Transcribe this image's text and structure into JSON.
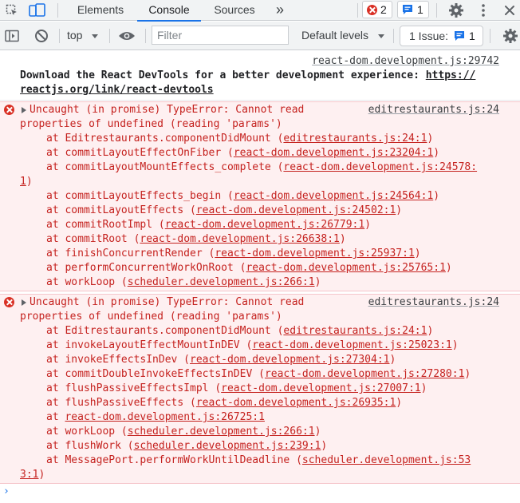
{
  "tabbar": {
    "tabs": [
      {
        "label": "Elements",
        "active": false
      },
      {
        "label": "Console",
        "active": true
      },
      {
        "label": "Sources",
        "active": false
      }
    ],
    "more_icon": "»",
    "error_count": "2",
    "message_count": "1"
  },
  "filterbar": {
    "context": "top",
    "filter_placeholder": "Filter",
    "levels": "Default levels",
    "issues_label": "1 Issue:",
    "issues_count": "1"
  },
  "console": {
    "info": {
      "source": "react-dom.development.js:29742",
      "text": "Download the React DevTools for a better development experience: ",
      "link_part1": "https://",
      "link_part2": "reactjs.org/link/react-devtools"
    },
    "errors": [
      {
        "head1": "Uncaught (in promise) TypeError: Cannot read",
        "head2": "properties of undefined (reading 'params')",
        "source": "editrestaurants.js:24",
        "stack": [
          {
            "prefix": "at Editrestaurants.componentDidMount (",
            "link": "editrestaurants.js:24:1",
            "suffix": ")"
          },
          {
            "prefix": "at commitLayoutEffectOnFiber (",
            "link": "react-dom.development.js:23204:1",
            "suffix": ")"
          },
          {
            "prefix": "at commitLayoutMountEffects_complete (",
            "link": "react-dom.development.js:24578:",
            "suffix": ""
          },
          {
            "prefix": "",
            "link": "1",
            "suffix": ")"
          },
          {
            "prefix": "at commitLayoutEffects_begin (",
            "link": "react-dom.development.js:24564:1",
            "suffix": ")"
          },
          {
            "prefix": "at commitLayoutEffects (",
            "link": "react-dom.development.js:24502:1",
            "suffix": ")"
          },
          {
            "prefix": "at commitRootImpl (",
            "link": "react-dom.development.js:26779:1",
            "suffix": ")"
          },
          {
            "prefix": "at commitRoot (",
            "link": "react-dom.development.js:26638:1",
            "suffix": ")"
          },
          {
            "prefix": "at finishConcurrentRender (",
            "link": "react-dom.development.js:25937:1",
            "suffix": ")"
          },
          {
            "prefix": "at performConcurrentWorkOnRoot (",
            "link": "react-dom.development.js:25765:1",
            "suffix": ")"
          },
          {
            "prefix": "at workLoop (",
            "link": "scheduler.development.js:266:1",
            "suffix": ")"
          }
        ]
      },
      {
        "head1": "Uncaught (in promise) TypeError: Cannot read",
        "head2": "properties of undefined (reading 'params')",
        "source": "editrestaurants.js:24",
        "stack": [
          {
            "prefix": "at Editrestaurants.componentDidMount (",
            "link": "editrestaurants.js:24:1",
            "suffix": ")"
          },
          {
            "prefix": "at invokeLayoutEffectMountInDEV (",
            "link": "react-dom.development.js:25023:1",
            "suffix": ")"
          },
          {
            "prefix": "at invokeEffectsInDev (",
            "link": "react-dom.development.js:27304:1",
            "suffix": ")"
          },
          {
            "prefix": "at commitDoubleInvokeEffectsInDEV (",
            "link": "react-dom.development.js:27280:1",
            "suffix": ")"
          },
          {
            "prefix": "at flushPassiveEffectsImpl (",
            "link": "react-dom.development.js:27007:1",
            "suffix": ")"
          },
          {
            "prefix": "at flushPassiveEffects (",
            "link": "react-dom.development.js:26935:1",
            "suffix": ")"
          },
          {
            "prefix": "at ",
            "link": "react-dom.development.js:26725:1",
            "suffix": ""
          },
          {
            "prefix": "at workLoop (",
            "link": "scheduler.development.js:266:1",
            "suffix": ")"
          },
          {
            "prefix": "at flushWork (",
            "link": "scheduler.development.js:239:1",
            "suffix": ")"
          },
          {
            "prefix": "at MessagePort.performWorkUntilDeadline (",
            "link": "scheduler.development.js:53",
            "suffix": ""
          },
          {
            "prefix": "",
            "link": "3:1",
            "suffix": ")"
          }
        ]
      }
    ],
    "prompt": "›"
  },
  "colors": {
    "error_red": "#c5221f",
    "error_bg": "#fef0f1",
    "accent_blue": "#1a73e8",
    "toolbar_bg": "#f1f3f4"
  }
}
